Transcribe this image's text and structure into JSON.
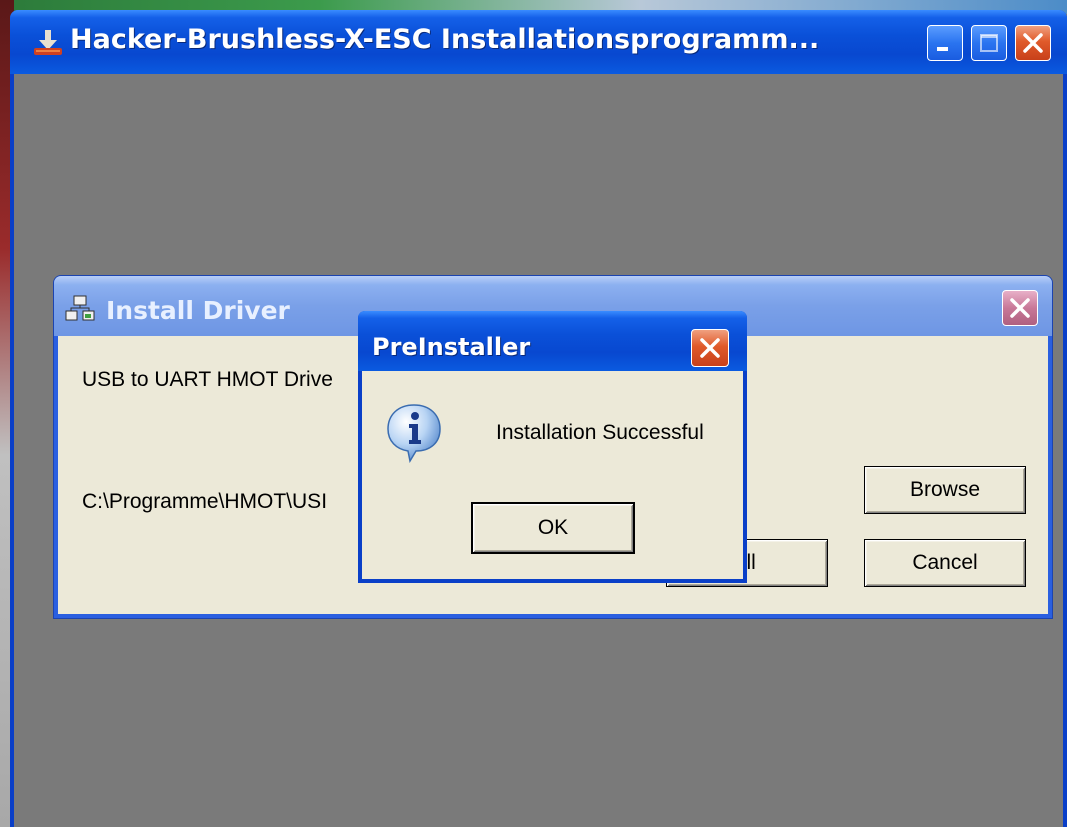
{
  "main_window": {
    "title": "Hacker-Brushless-X-ESC Installationsprogramm...",
    "icon": "installer-arrow-icon",
    "controls": [
      "minimize-icon",
      "maximize-icon",
      "close-icon"
    ]
  },
  "install_driver_dialog": {
    "title": "Install Driver",
    "icon": "network-driver-icon",
    "driver_label": "USB to UART HMOT Drive",
    "install_path": "C:\\Programme\\HMOT\\USI",
    "buttons": {
      "browse": "Browse",
      "install": "tall",
      "cancel": "Cancel"
    }
  },
  "message_box": {
    "title": "PreInstaller",
    "icon": "info-icon",
    "message": "Installation Successful",
    "ok_label": "OK"
  },
  "colors": {
    "titlebar_blue": "#0a50d8",
    "inactive_titlebar": "#7aa0e8",
    "close_red": "#e05a2a",
    "dialog_face": "#ece9d8",
    "client_gray": "#7a7a7a"
  }
}
